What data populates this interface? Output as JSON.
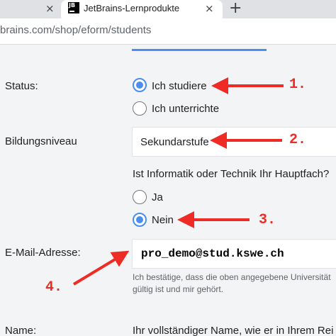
{
  "browser": {
    "tabs": [
      {
        "title": "",
        "close": "×"
      },
      {
        "title": "JetBrains-Lernprodukte",
        "close": "×",
        "favicon": "JB"
      }
    ],
    "new_tab": "+",
    "url": "brains.com/shop/eform/students"
  },
  "form": {
    "status_label": "Status:",
    "status_options": [
      {
        "label": "Ich studiere",
        "checked": true
      },
      {
        "label": "Ich unterrichte",
        "checked": false
      }
    ],
    "education_label": "Bildungsniveau",
    "education_value": "Sekundarstufe",
    "major_question": "Ist Informatik oder Technik Ihr Hauptfach?",
    "major_options": [
      {
        "label": "Ja",
        "checked": false
      },
      {
        "label": "Nein",
        "checked": true
      }
    ],
    "email_label": "E-Mail-Adresse:",
    "email_value": "pro_demo@stud.kswe.ch",
    "hint_line1": "Ich bestätige, dass die oben angegebene Universität",
    "hint_line2": "gültig ist und mir gehört.",
    "name_label": "Name:",
    "name_hint": "Ihr vollständiger Name, wie er in Ihrem Rei"
  },
  "annotations": {
    "a1": "1.",
    "a2": "2.",
    "a3": "3.",
    "a4": "4.",
    "color": "#ee2b24"
  },
  "colors": {
    "accent": "#4a8ef0",
    "page_bg": "#f3f4f5",
    "tabstrip_bg": "#dfe1e5"
  }
}
